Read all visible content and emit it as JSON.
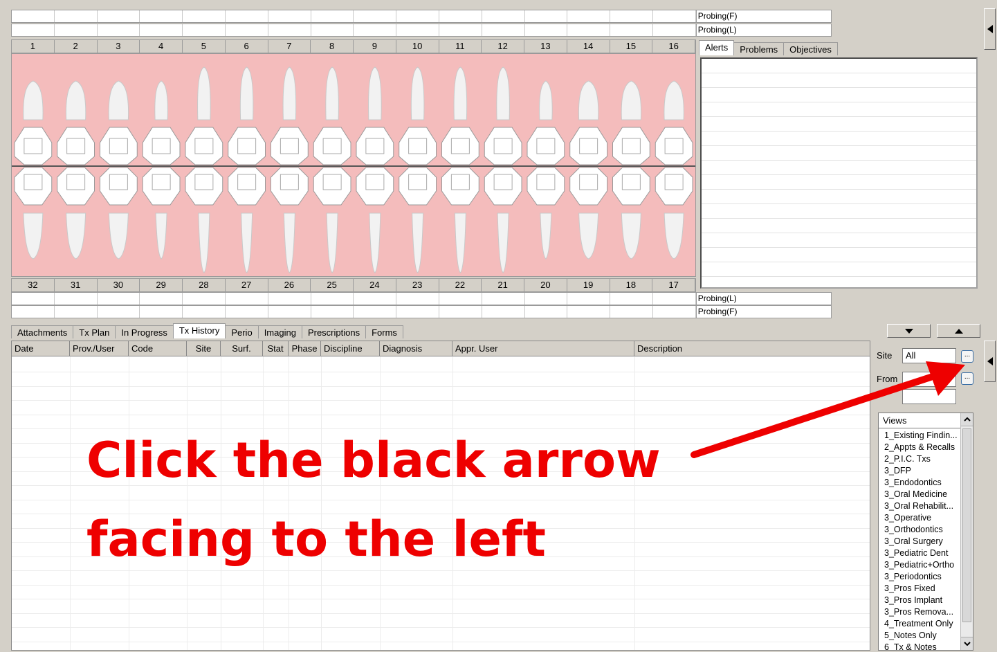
{
  "probing": {
    "upper_top": "Probing(F)",
    "upper_bottom": "Probing(L)",
    "lower_top": "Probing(L)",
    "lower_bottom": "Probing(F)"
  },
  "upper_numbers": [
    "1",
    "2",
    "3",
    "4",
    "5",
    "6",
    "7",
    "8",
    "9",
    "10",
    "11",
    "12",
    "13",
    "14",
    "15",
    "16"
  ],
  "lower_numbers": [
    "32",
    "31",
    "30",
    "29",
    "28",
    "27",
    "26",
    "25",
    "24",
    "23",
    "22",
    "21",
    "20",
    "19",
    "18",
    "17"
  ],
  "side_tabs": [
    "Alerts",
    "Problems",
    "Objectives"
  ],
  "bottom_tabs": [
    "Attachments",
    "Tx Plan",
    "In Progress",
    "Tx History",
    "Perio",
    "Imaging",
    "Prescriptions",
    "Forms"
  ],
  "active_bottom_tab": "Tx History",
  "grid_columns": [
    "Date",
    "Prov./User",
    "Code",
    "Site",
    "Surf.",
    "Stat",
    "Phase",
    "Discipline",
    "Diagnosis",
    "Appr. User",
    "Description"
  ],
  "filters": {
    "site_label": "Site",
    "site_value": "All",
    "from_label": "From",
    "dots": "..."
  },
  "views": {
    "header": "Views",
    "items": [
      "1_Existing Findin...",
      "2_Appts & Recalls",
      "2_P.I.C. Txs",
      "3_DFP",
      "3_Endodontics",
      "3_Oral Medicine",
      "3_Oral Rehabilit...",
      "3_Operative",
      "3_Orthodontics",
      "3_Oral Surgery",
      "3_Pediatric Dent",
      "3_Pediatric+Ortho",
      "3_Periodontics",
      "3_Pros Fixed",
      "3_Pros Implant",
      "3_Pros Remova...",
      "4_Treatment Only",
      "5_Notes Only",
      "6_Tx & Notes"
    ]
  },
  "instruction": {
    "line1": "Click the black arrow",
    "line2": "facing to the left"
  },
  "colors": {
    "chart_bg": "#f4bcbc",
    "annotation": "#ee0000",
    "window_bg": "#d4d0c8"
  }
}
